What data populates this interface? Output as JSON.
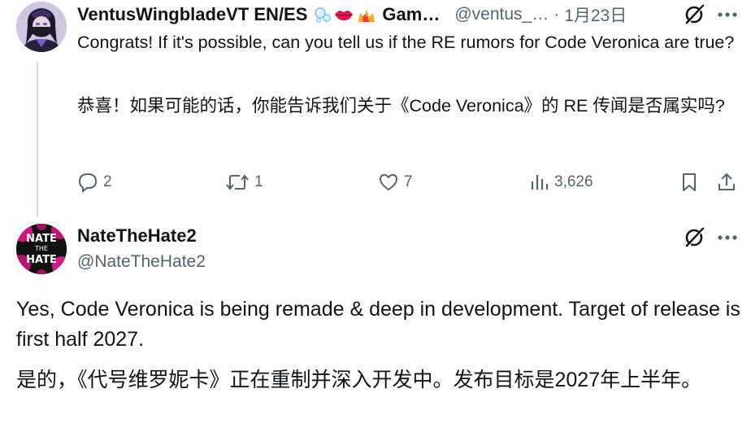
{
  "reply_tweet": {
    "display_name": "VentusWingbladeVT EN/ES",
    "name_suffix": "Gam…",
    "handle": "@ventus_…",
    "separator": "·",
    "date": "1月23日",
    "text_en": "Congrats! If it's possible, can you tell us if the RE rumors for Code Veronica are true?",
    "text_zh": "恭喜！如果可能的话，你能告诉我们关于《Code Veronica》的 RE 传闻是否属实吗?",
    "emojis": [
      "bubbles-emoji",
      "lips-emoji",
      "crown-fire-emoji"
    ],
    "actions": {
      "replies": "2",
      "retweets": "1",
      "likes": "7",
      "views": "3,626"
    }
  },
  "main_tweet": {
    "display_name": "NateTheHate2",
    "handle": "@NateTheHate2",
    "text_en": "Yes, Code Veronica is being remade & deep in development. Target of release is first half 2027.",
    "text_zh": "是的，《代号维罗妮卡》正在重制并深入开发中。发布目标是2027年上半年。",
    "avatar_text": [
      "NATE",
      "THE",
      "HATE"
    ]
  },
  "colors": {
    "text": "#0f1419",
    "secondary": "#536471",
    "thread_line": "#cfd9de",
    "avatar_magenta": "#d0157f"
  }
}
